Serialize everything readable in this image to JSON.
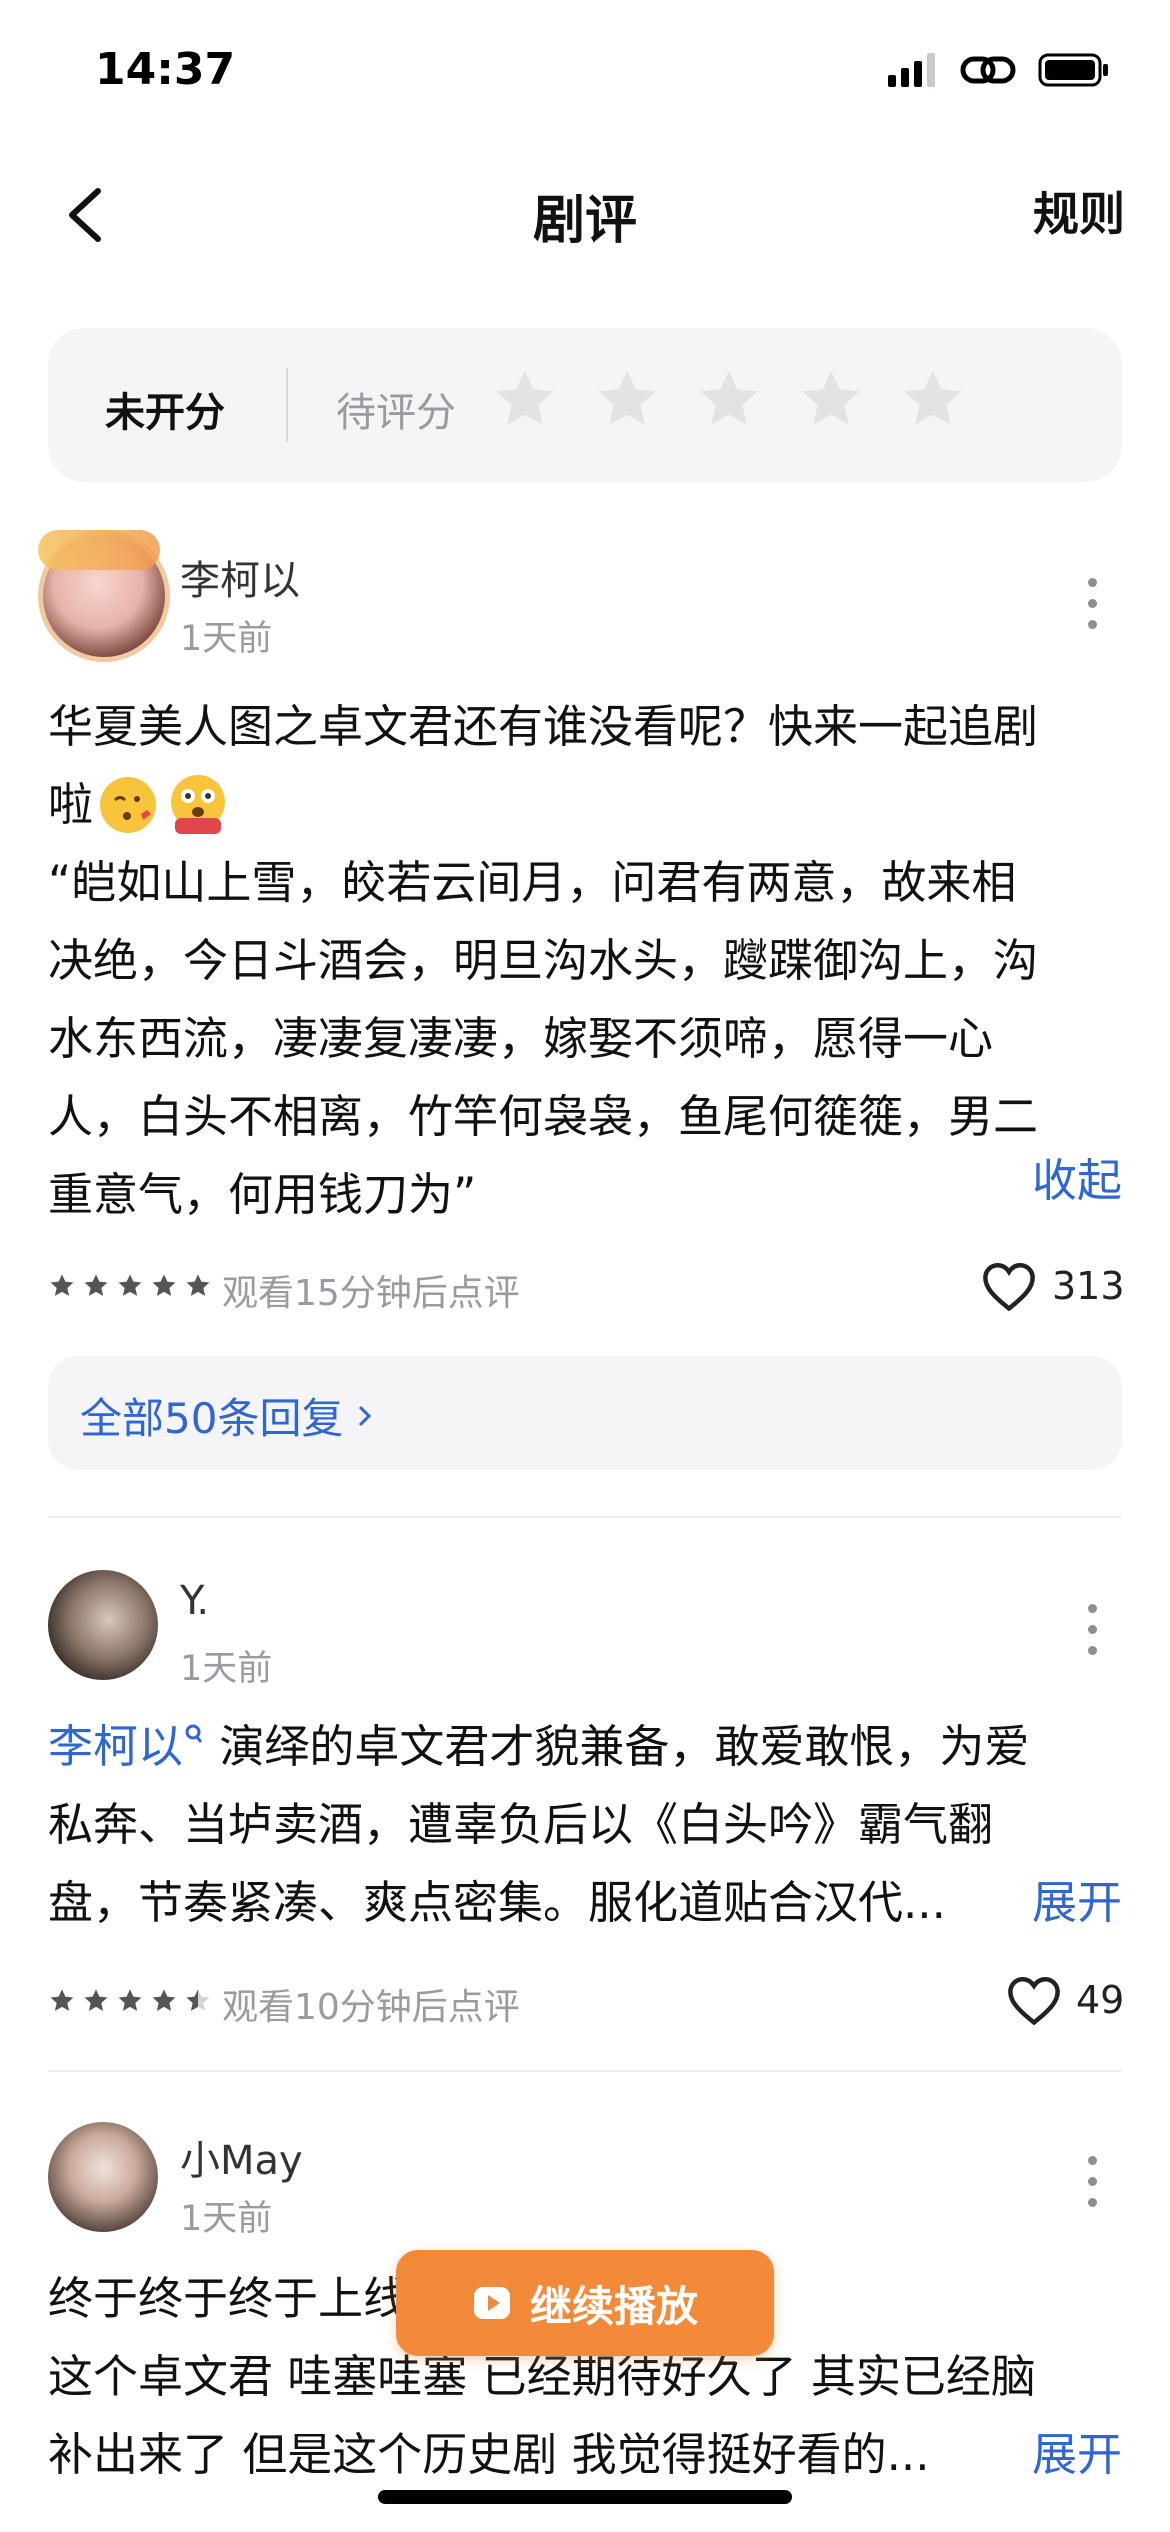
{
  "status_bar": {
    "time": "14:37"
  },
  "nav": {
    "title": "剧评",
    "rules": "规则"
  },
  "rating": {
    "label": "未开分",
    "pending": "待评分",
    "stars": 5
  },
  "reviews": [
    {
      "username": "李柯以",
      "time": "1天前",
      "text_lines": [
        "华夏美人图之卓文君还有谁没看呢？快来一起追剧",
        "啦",
        "“皑如山上雪，皎若云间月，问君有两意，故来相",
        "决绝，今日斗酒会，明旦沟水头，躞蹀御沟上，沟",
        "水东西流，凄凄复凄凄，嫁娶不须啼，愿得一心",
        "人，白头不相离，竹竿何袅袅，鱼尾何簁簁，男二",
        "重意气，何用钱刀为”"
      ],
      "toggle": "收起",
      "rating": 5,
      "meta": "观看15分钟后点评",
      "likes": "313",
      "replies": "全部50条回复"
    },
    {
      "username": "Y.",
      "time": "1天前",
      "mention": "李柯以",
      "text_lines": [
        "演绎的卓文君才貌兼备，敢爱敢恨，为爱",
        "私奔、当垆卖酒，遭辜负后以《白头吟》霸气翻",
        "盘，节奏紧凑、爽点密集。服化道贴合汉代..."
      ],
      "toggle": "展开",
      "rating": 4.5,
      "meta": "观看10分钟后点评",
      "likes": "49"
    },
    {
      "username": "小May",
      "time": "1天前",
      "text_lines": [
        "终于终于终于上线",
        "这个卓文君 哇塞哇塞 已经期待好久了 其实已经脑",
        "补出来了 但是这个历史剧 我觉得挺好看的..."
      ],
      "toggle": "展开"
    }
  ],
  "play_button": {
    "label": "继续播放"
  },
  "colors": {
    "accent": "#2f66d3",
    "play": "#f28a3a",
    "star_gray": "#e3e3e6"
  }
}
